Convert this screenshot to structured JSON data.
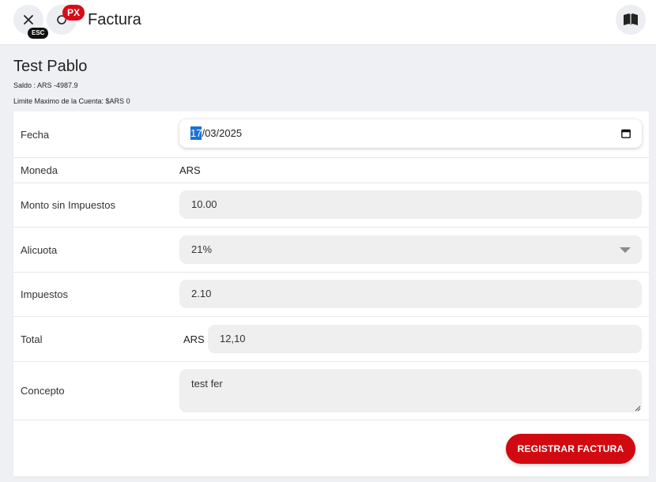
{
  "header": {
    "title": "Factura",
    "esc_badge": "ESC",
    "px_badge": "PX",
    "icons": {
      "close": "close-icon",
      "reload": "reload-icon",
      "book": "book-icon"
    }
  },
  "client": {
    "name": "Test Pablo",
    "saldo": "Saldo : ARS -4987.9",
    "limite": "Limite Maximo de la Cuenta: $ARS 0"
  },
  "form": {
    "fecha": {
      "label": "Fecha",
      "day": "17",
      "rest": "/03/2025"
    },
    "moneda": {
      "label": "Moneda",
      "value": "ARS"
    },
    "monto": {
      "label": "Monto sin Impuestos",
      "value": "10.00"
    },
    "alicuota": {
      "label": "Alicuota",
      "value": "21%"
    },
    "impuestos": {
      "label": "Impuestos",
      "value": "2.10"
    },
    "total": {
      "label": "Total",
      "currency": "ARS",
      "value": "12,10"
    },
    "concepto": {
      "label": "Concepto",
      "value": "test fer"
    }
  },
  "actions": {
    "submit_label": "REGISTRAR FACTURA"
  },
  "colors": {
    "accent": "#d10a11",
    "selection": "#1a73d9",
    "badge_dark": "#111111"
  }
}
